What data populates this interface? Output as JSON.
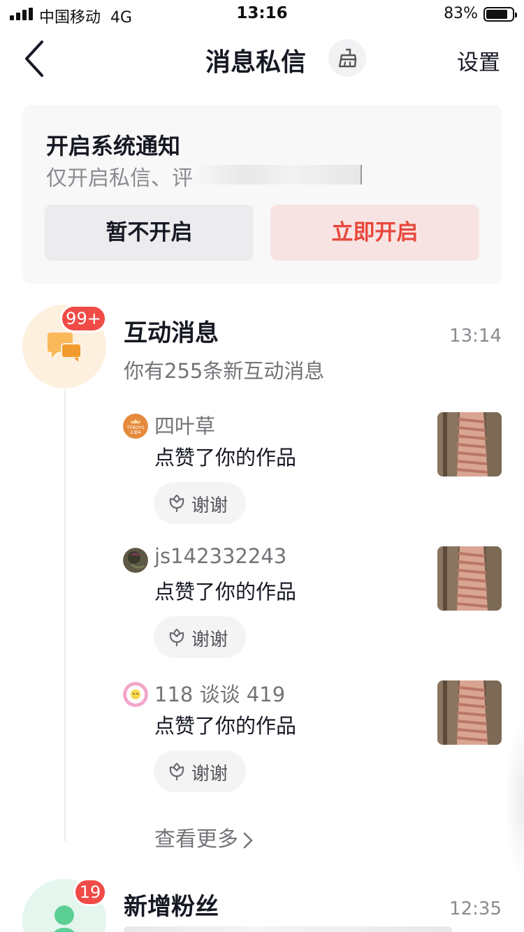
{
  "status_bar": {
    "carrier": "中国移动",
    "network": "4G",
    "time": "13:16",
    "battery_percent": "83%",
    "battery_level": 0.83
  },
  "nav": {
    "title": "消息私信",
    "settings_label": "设置",
    "back_icon": "chevron-left-icon",
    "clean_icon": "broom-icon"
  },
  "notify_card": {
    "title": "开启系统通知",
    "description": "仅开启私信、评",
    "later_label": "暂不开启",
    "enable_label": "立即开启",
    "accent_color": "#e8473b"
  },
  "interactions": {
    "badge": "99+",
    "title": "互动消息",
    "time": "13:14",
    "subtitle": "你有255条新互动消息",
    "icon": "chat-bubbles-icon",
    "items": [
      {
        "name": "四叶草",
        "action": "点赞了你的作品",
        "thanks_label": "谢谢",
        "avatar_text": "TFBOYS 五周年"
      },
      {
        "name": "js142332243",
        "action": "点赞了你的作品",
        "thanks_label": "谢谢"
      },
      {
        "name": "118 谈谈 419",
        "action": "点赞了你的作品",
        "thanks_label": "谢谢"
      }
    ],
    "see_more": "查看更多"
  },
  "fans": {
    "badge": "19",
    "title": "新增粉丝",
    "time": "12:35",
    "icon": "person-heart-icon"
  }
}
